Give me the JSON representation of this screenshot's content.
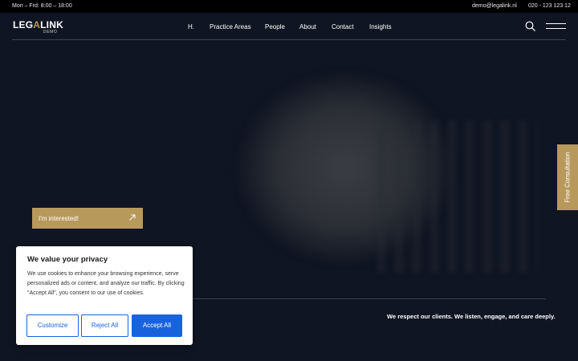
{
  "topbar": {
    "hours": "Mon – Frd: 8:00 – 18:00",
    "email": "demo@legalink.nl",
    "phone": "020 - 123 123 12"
  },
  "header": {
    "logo_main_a": "LEG",
    "logo_main_b": "A",
    "logo_main_c": "LINK",
    "logo_sub": "DEMO",
    "nav": {
      "home": "H.",
      "practice_areas": "Practice Areas",
      "people": "People",
      "about": "About",
      "contact": "Contact",
      "insights": "Insights"
    }
  },
  "hero": {
    "cta_label": "I'm interested!",
    "tagline": "We respect our clients. We listen, engage, and care deeply."
  },
  "side_tab": {
    "label": "Free Consultation"
  },
  "cookie_banner": {
    "title": "We value your privacy",
    "body": "We use cookies to enhance your browsing experience, serve personalized ads or content, and analyze our traffic. By clicking \"Accept All\", you consent to our use of cookies.",
    "customize_label": "Customize",
    "reject_label": "Reject All",
    "accept_label": "Accept All"
  },
  "colors": {
    "background": "#0f1522",
    "accent_gold": "#b8995c",
    "cookie_blue": "#1863dc"
  },
  "icons": {
    "search": "search-icon",
    "menu": "hamburger-menu-icon",
    "arrow": "arrow-up-right-icon"
  }
}
